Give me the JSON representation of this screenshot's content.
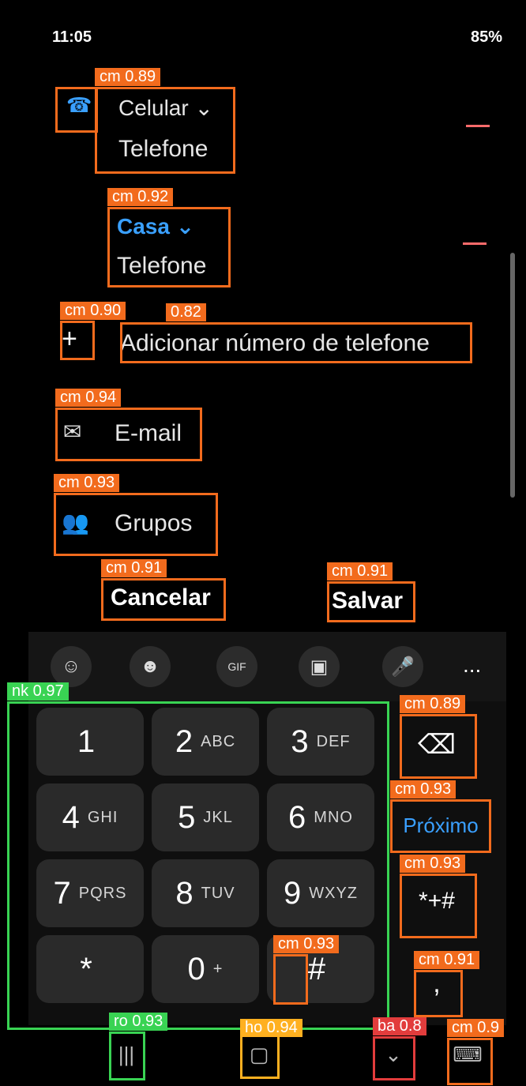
{
  "status": {
    "time": "11:05",
    "battery": "85%"
  },
  "contact": {
    "phone1": {
      "type": "Celular",
      "label": "Telefone"
    },
    "phone2": {
      "type": "Casa",
      "label": "Telefone"
    },
    "add_phone": "Adicionar número de telefone",
    "email": "E-mail",
    "groups": "Grupos"
  },
  "actions": {
    "cancel": "Cancelar",
    "save": "Salvar"
  },
  "toolbar": {
    "more": "..."
  },
  "keypad": {
    "rows": [
      [
        {
          "n": "1",
          "l": ""
        },
        {
          "n": "2",
          "l": "ABC"
        },
        {
          "n": "3",
          "l": "DEF"
        }
      ],
      [
        {
          "n": "4",
          "l": "GHI"
        },
        {
          "n": "5",
          "l": "JKL"
        },
        {
          "n": "6",
          "l": "MNO"
        }
      ],
      [
        {
          "n": "7",
          "l": "PQRS"
        },
        {
          "n": "8",
          "l": "TUV"
        },
        {
          "n": "9",
          "l": "WXYZ"
        }
      ],
      [
        {
          "n": "*",
          "l": ""
        },
        {
          "n": "0",
          "l": "+"
        },
        {
          "n": "#",
          "l": ""
        }
      ]
    ],
    "next": "Próximo",
    "symbols": "*+#",
    "comma": ","
  },
  "overlay_tags": {
    "t1": "cm 0.89",
    "t2": "cm 0.92",
    "t3": "cm 0.90",
    "t4": "0.82",
    "t5": "cm 0.94",
    "t6": "cm 0.93",
    "t7": "cm 0.91",
    "t8": "cm 0.91",
    "t9": "nk 0.97",
    "t10": "cm 0.89",
    "t11": "cm 0.93",
    "t12": "cm 0.93",
    "t13": "cm 0.93",
    "t14": "cm 0.91",
    "t15": "ro 0.93",
    "t16": "ho 0.94",
    "t17": "ba 0.8",
    "t18": "cm 0.9"
  }
}
